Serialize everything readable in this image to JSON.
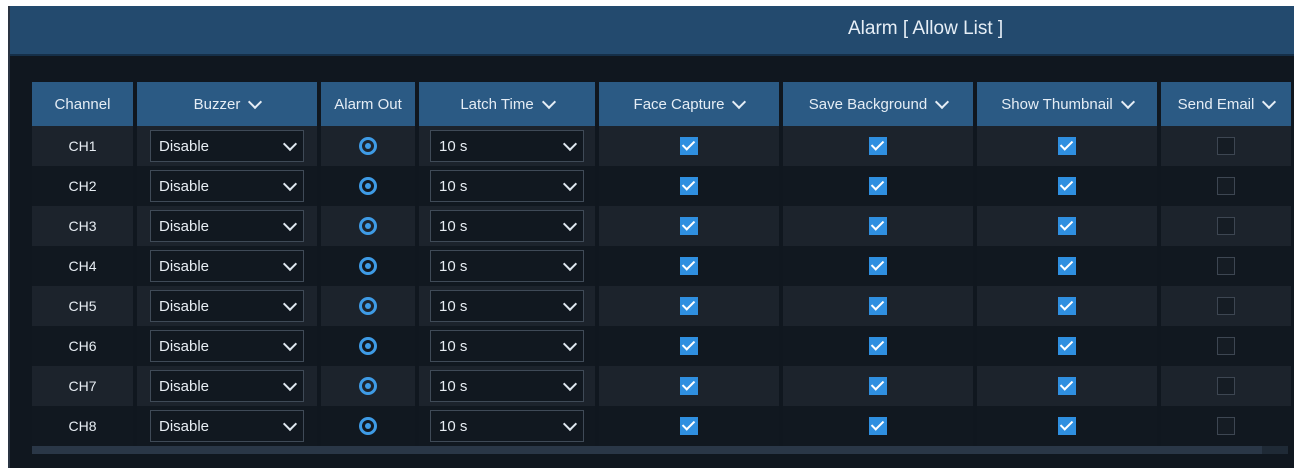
{
  "window": {
    "title": "Alarm [ Allow List ]"
  },
  "table": {
    "headers": [
      {
        "label": "Channel",
        "has_dropdown": false
      },
      {
        "label": "Buzzer",
        "has_dropdown": true
      },
      {
        "label": "Alarm Out",
        "has_dropdown": false
      },
      {
        "label": "Latch Time",
        "has_dropdown": true
      },
      {
        "label": "Face Capture",
        "has_dropdown": true
      },
      {
        "label": "Save Background",
        "has_dropdown": true
      },
      {
        "label": "Show Thumbnail",
        "has_dropdown": true
      },
      {
        "label": "Send Email",
        "has_dropdown": true
      }
    ],
    "rows": [
      {
        "channel": "CH1",
        "buzzer": "Disable",
        "latch": "10 s",
        "face": true,
        "bg": true,
        "thumb": true,
        "email": false
      },
      {
        "channel": "CH2",
        "buzzer": "Disable",
        "latch": "10 s",
        "face": true,
        "bg": true,
        "thumb": true,
        "email": false
      },
      {
        "channel": "CH3",
        "buzzer": "Disable",
        "latch": "10 s",
        "face": true,
        "bg": true,
        "thumb": true,
        "email": false
      },
      {
        "channel": "CH4",
        "buzzer": "Disable",
        "latch": "10 s",
        "face": true,
        "bg": true,
        "thumb": true,
        "email": false
      },
      {
        "channel": "CH5",
        "buzzer": "Disable",
        "latch": "10 s",
        "face": true,
        "bg": true,
        "thumb": true,
        "email": false
      },
      {
        "channel": "CH6",
        "buzzer": "Disable",
        "latch": "10 s",
        "face": true,
        "bg": true,
        "thumb": true,
        "email": false
      },
      {
        "channel": "CH7",
        "buzzer": "Disable",
        "latch": "10 s",
        "face": true,
        "bg": true,
        "thumb": true,
        "email": false
      },
      {
        "channel": "CH8",
        "buzzer": "Disable",
        "latch": "10 s",
        "face": true,
        "bg": true,
        "thumb": true,
        "email": false
      }
    ]
  },
  "icons": {
    "alarm_out": "gear-icon",
    "dropdown": "chevron-down-icon"
  },
  "colors": {
    "header_bg": "#2b5a84",
    "title_bg": "#234a6e",
    "accent": "#2f8fe0",
    "bg": "#10171f"
  }
}
